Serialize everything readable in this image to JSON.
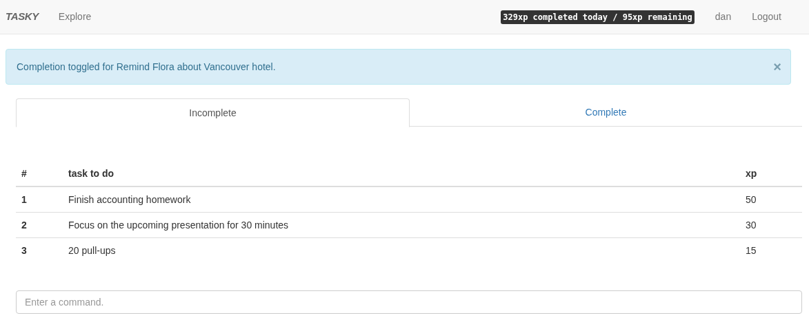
{
  "navbar": {
    "brand": "TASKY",
    "links": [
      "Explore"
    ],
    "xp_badge": "329xp completed today / 95xp remaining",
    "user": "dan",
    "logout": "Logout"
  },
  "alert": {
    "message": "Completion toggled for Remind Flora about Vancouver hotel.",
    "close": "×"
  },
  "tabs": [
    {
      "label": "Incomplete",
      "selected": true
    },
    {
      "label": "Complete",
      "selected": false
    }
  ],
  "table": {
    "columns": [
      "#",
      "task to do",
      "xp"
    ],
    "rows": [
      [
        "1",
        "Finish accounting homework",
        "50"
      ],
      [
        "2",
        "Focus on the upcoming presentation for 30 minutes",
        "30"
      ],
      [
        "3",
        "20 pull-ups",
        "15"
      ]
    ]
  },
  "command": {
    "placeholder": "Enter a command."
  }
}
